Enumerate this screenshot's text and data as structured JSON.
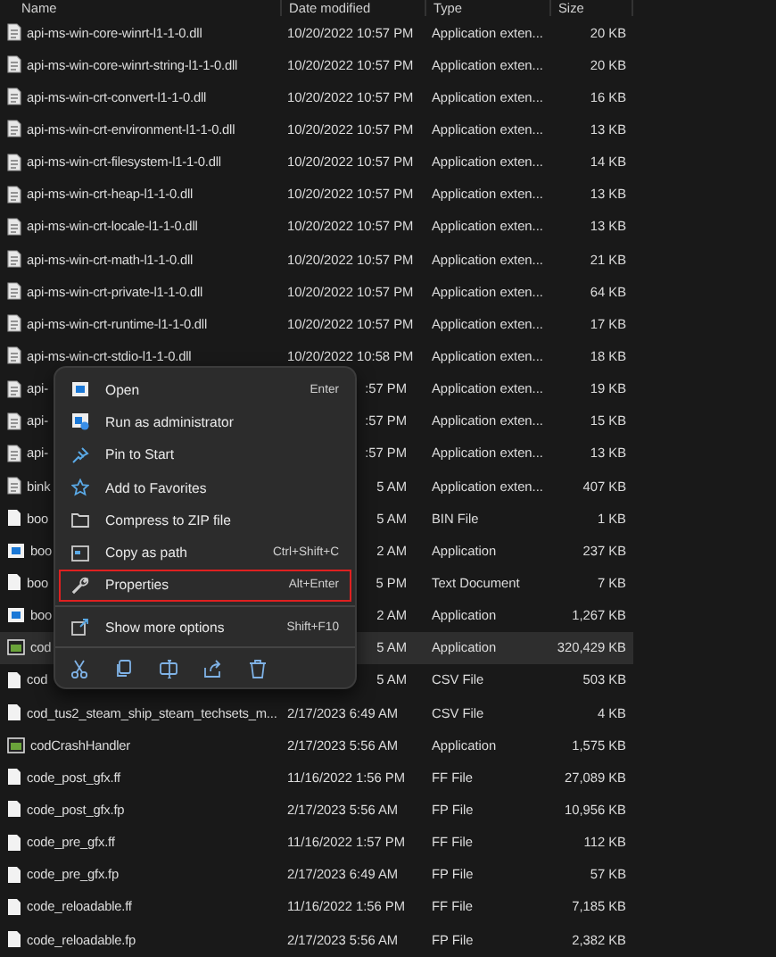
{
  "columns": [
    "Name",
    "Date modified",
    "Type",
    "Size"
  ],
  "rows": [
    {
      "kind": "dll",
      "name": "api-ms-win-core-winrt-l1-1-0.dll",
      "date": "10/20/2022 10:57 PM",
      "type": "Application exten...",
      "size": "20 KB",
      "selected": false
    },
    {
      "kind": "dll",
      "name": "api-ms-win-core-winrt-string-l1-1-0.dll",
      "date": "10/20/2022 10:57 PM",
      "type": "Application exten...",
      "size": "20 KB",
      "selected": false
    },
    {
      "kind": "dll",
      "name": "api-ms-win-crt-convert-l1-1-0.dll",
      "date": "10/20/2022 10:57 PM",
      "type": "Application exten...",
      "size": "16 KB",
      "selected": false
    },
    {
      "kind": "dll",
      "name": "api-ms-win-crt-environment-l1-1-0.dll",
      "date": "10/20/2022 10:57 PM",
      "type": "Application exten...",
      "size": "13 KB",
      "selected": false
    },
    {
      "kind": "dll",
      "name": "api-ms-win-crt-filesystem-l1-1-0.dll",
      "date": "10/20/2022 10:57 PM",
      "type": "Application exten...",
      "size": "14 KB",
      "selected": false
    },
    {
      "kind": "dll",
      "name": "api-ms-win-crt-heap-l1-1-0.dll",
      "date": "10/20/2022 10:57 PM",
      "type": "Application exten...",
      "size": "13 KB",
      "selected": false
    },
    {
      "kind": "dll",
      "name": "api-ms-win-crt-locale-l1-1-0.dll",
      "date": "10/20/2022 10:57 PM",
      "type": "Application exten...",
      "size": "13 KB",
      "selected": false
    },
    {
      "kind": "dll",
      "name": "api-ms-win-crt-math-l1-1-0.dll",
      "date": "10/20/2022 10:57 PM",
      "type": "Application exten...",
      "size": "21 KB",
      "selected": false
    },
    {
      "kind": "dll",
      "name": "api-ms-win-crt-private-l1-1-0.dll",
      "date": "10/20/2022 10:57 PM",
      "type": "Application exten...",
      "size": "64 KB",
      "selected": false
    },
    {
      "kind": "dll",
      "name": "api-ms-win-crt-runtime-l1-1-0.dll",
      "date": "10/20/2022 10:57 PM",
      "type": "Application exten...",
      "size": "17 KB",
      "selected": false
    },
    {
      "kind": "dll",
      "name": "api-ms-win-crt-stdio-l1-1-0.dll",
      "date": "10/20/2022 10:58 PM",
      "type": "Application exten...",
      "size": "18 KB",
      "selected": false
    },
    {
      "kind": "dll",
      "name": "api-",
      "date": ":57 PM",
      "type": "Application exten...",
      "size": "19 KB",
      "selected": false
    },
    {
      "kind": "dll",
      "name": "api-",
      "date": ":57 PM",
      "type": "Application exten...",
      "size": "15 KB",
      "selected": false
    },
    {
      "kind": "dll",
      "name": "api-",
      "date": ":57 PM",
      "type": "Application exten...",
      "size": "13 KB",
      "selected": false
    },
    {
      "kind": "dll",
      "name": "bink",
      "date": "5 AM",
      "type": "Application exten...",
      "size": "407 KB",
      "selected": false
    },
    {
      "kind": "file",
      "name": "boo",
      "date": "5 AM",
      "type": "BIN File",
      "size": "1 KB",
      "selected": false
    },
    {
      "kind": "app",
      "name": "boo",
      "date": "2 AM",
      "type": "Application",
      "size": "237 KB",
      "selected": false
    },
    {
      "kind": "file",
      "name": "boo",
      "date": "5 PM",
      "type": "Text Document",
      "size": "7 KB",
      "selected": false
    },
    {
      "kind": "app",
      "name": "boo",
      "date": "2 AM",
      "type": "Application",
      "size": "1,267 KB",
      "selected": false
    },
    {
      "kind": "game",
      "name": "cod",
      "date": "5 AM",
      "type": "Application",
      "size": "320,429 KB",
      "selected": true
    },
    {
      "kind": "file",
      "name": "cod",
      "date": "5 AM",
      "type": "CSV File",
      "size": "503 KB",
      "selected": false
    },
    {
      "kind": "file",
      "name": "cod_tus2_steam_ship_steam_techsets_m...",
      "date": "2/17/2023 6:49 AM",
      "type": "CSV File",
      "size": "4 KB",
      "selected": false
    },
    {
      "kind": "game",
      "name": "codCrashHandler",
      "date": "2/17/2023 5:56 AM",
      "type": "Application",
      "size": "1,575 KB",
      "selected": false
    },
    {
      "kind": "file",
      "name": "code_post_gfx.ff",
      "date": "11/16/2022 1:56 PM",
      "type": "FF File",
      "size": "27,089 KB",
      "selected": false
    },
    {
      "kind": "file",
      "name": "code_post_gfx.fp",
      "date": "2/17/2023 5:56 AM",
      "type": "FP File",
      "size": "10,956 KB",
      "selected": false
    },
    {
      "kind": "file",
      "name": "code_pre_gfx.ff",
      "date": "11/16/2022 1:57 PM",
      "type": "FF File",
      "size": "112 KB",
      "selected": false
    },
    {
      "kind": "file",
      "name": "code_pre_gfx.fp",
      "date": "2/17/2023 6:49 AM",
      "type": "FP File",
      "size": "57 KB",
      "selected": false
    },
    {
      "kind": "file",
      "name": "code_reloadable.ff",
      "date": "11/16/2022 1:56 PM",
      "type": "FF File",
      "size": "7,185 KB",
      "selected": false
    },
    {
      "kind": "file",
      "name": "code_reloadable.fp",
      "date": "2/17/2023 5:56 AM",
      "type": "FP File",
      "size": "2,382 KB",
      "selected": false
    }
  ],
  "menu": {
    "items": [
      {
        "kind": "open",
        "label": "Open",
        "shortcut": "Enter",
        "highlighted": false
      },
      {
        "kind": "admin",
        "label": "Run as administrator",
        "highlighted": false
      },
      {
        "kind": "pin",
        "label": "Pin to Start",
        "highlighted": false
      },
      {
        "kind": "star",
        "label": "Add to Favorites",
        "highlighted": false
      },
      {
        "kind": "zip",
        "label": "Compress to ZIP file",
        "highlighted": false
      },
      {
        "kind": "path",
        "label": "Copy as path",
        "shortcut": "Ctrl+Shift+C",
        "highlighted": false
      },
      {
        "kind": "wrench",
        "label": "Properties",
        "shortcut": "Alt+Enter",
        "highlighted": true
      },
      {
        "kind": "more",
        "label": "Show more options",
        "shortcut": "Shift+F10",
        "highlighted": false
      }
    ]
  }
}
